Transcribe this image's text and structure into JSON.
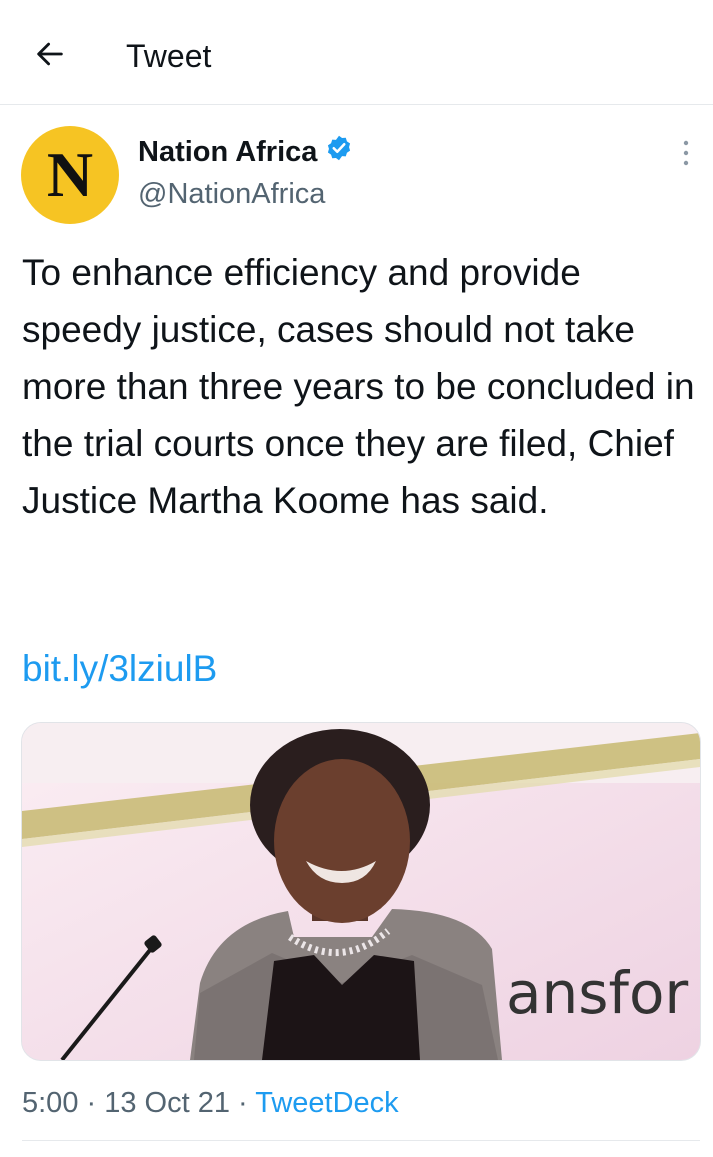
{
  "header": {
    "title": "Tweet",
    "back_icon": "arrow-left-icon"
  },
  "author": {
    "avatar_letter": "N",
    "avatar_color": "#f6c423",
    "display_name": "Nation Africa",
    "verified_icon": "verified-badge-icon",
    "verified_color": "#1d9bf0",
    "handle": "@NationAfrica",
    "more_icon": "more-vertical-icon"
  },
  "tweet": {
    "text": "To enhance efficiency and provide speedy justice, cases should not take more than three years to be concluded in the trial courts once they are filed, Chief Justice Martha Koome has said.",
    "link": "bit.ly/3lziulB",
    "media": {
      "background_text": "ansfor"
    },
    "time": "5:00",
    "date": "13 Oct 21",
    "source": "TweetDeck"
  }
}
